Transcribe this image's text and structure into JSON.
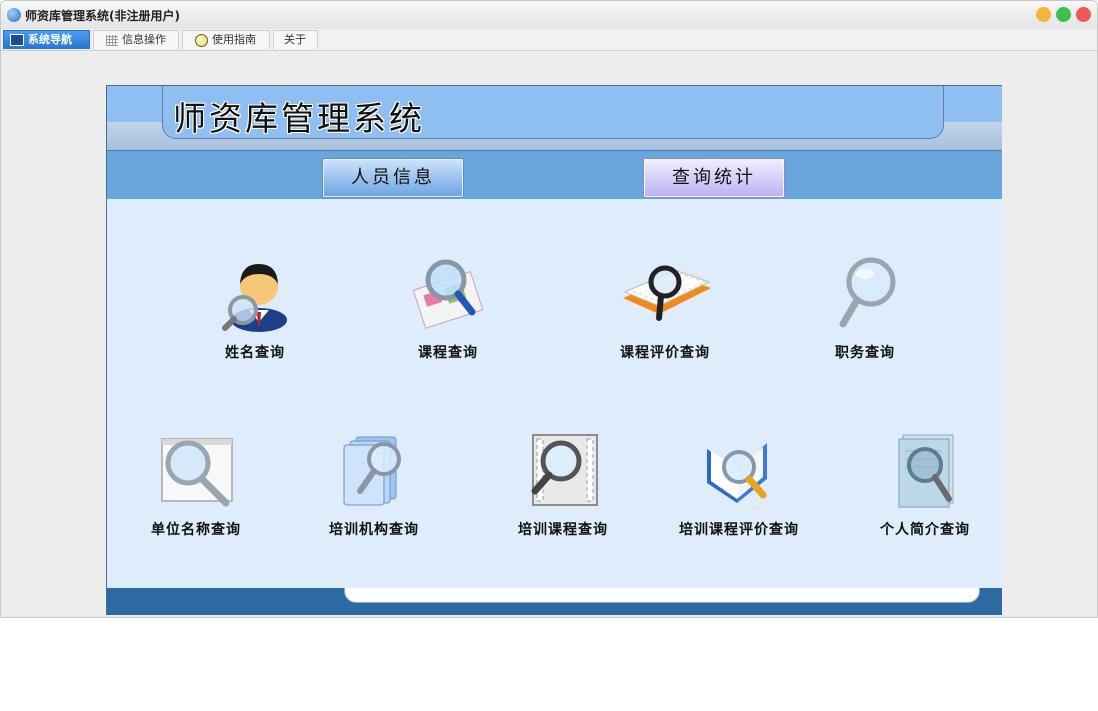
{
  "window": {
    "title": "师资库管理系统(非注册用户)"
  },
  "tabs": [
    {
      "label": "系统导航",
      "icon": "screen-icon",
      "active": true
    },
    {
      "label": "信息操作",
      "icon": "grid-icon",
      "active": false
    },
    {
      "label": "使用指南",
      "icon": "bulb-icon",
      "active": false
    },
    {
      "label": "关于",
      "icon": "",
      "active": false
    }
  ],
  "banner": {
    "title": "师资库管理系统"
  },
  "nav": {
    "left_label": "人员信息",
    "right_label": "查询统计"
  },
  "queries_row1": [
    {
      "label": "姓名查询",
      "icon": "person-search-icon"
    },
    {
      "label": "课程查询",
      "icon": "map-search-icon"
    },
    {
      "label": "课程评价查询",
      "icon": "book-search-icon"
    },
    {
      "label": "职务查询",
      "icon": "magnifier-icon"
    }
  ],
  "queries_row2": [
    {
      "label": "单位名称查询",
      "icon": "window-search-icon"
    },
    {
      "label": "培训机构查询",
      "icon": "folder-search-icon"
    },
    {
      "label": "培训课程查询",
      "icon": "film-search-icon"
    },
    {
      "label": "培训课程评价查询",
      "icon": "open-book-search-icon"
    },
    {
      "label": "个人简介查询",
      "icon": "document-search-icon"
    }
  ],
  "colors": {
    "banner": "#8fbff0",
    "nav_strip": "#6aa6de",
    "content": "#dfecfb",
    "footer": "#2d6aa2",
    "active_tab": "#2777d3"
  }
}
